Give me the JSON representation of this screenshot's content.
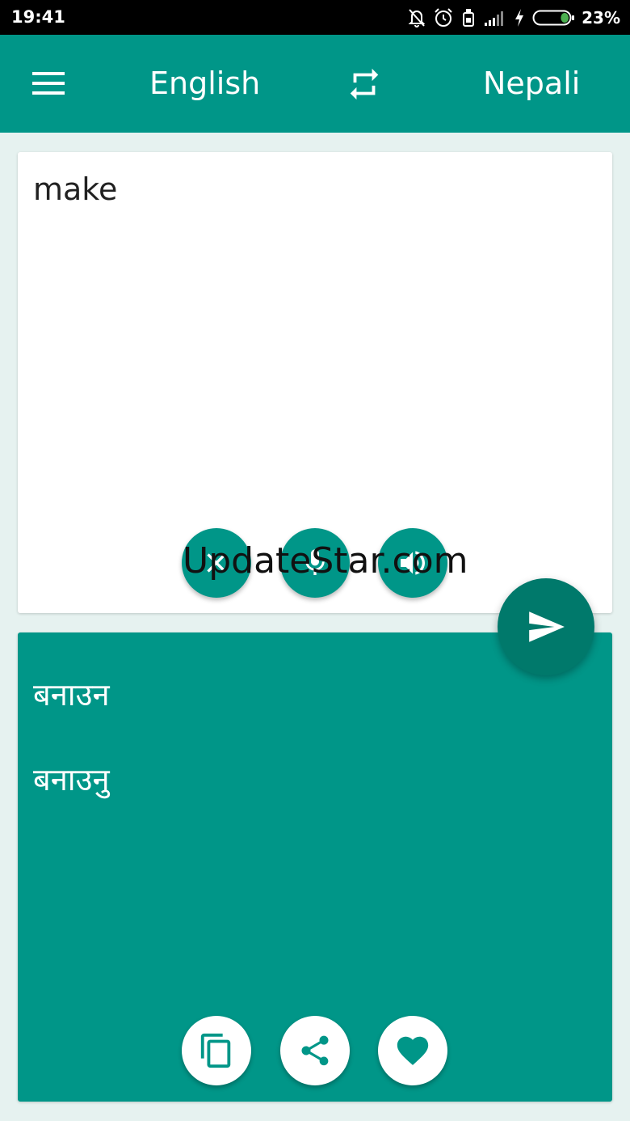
{
  "status_bar": {
    "time": "19:41",
    "battery_percent": "23%",
    "battery_level": 0.23,
    "icons": [
      "notifications-off-icon",
      "alarm-icon",
      "device-icon",
      "signal-icon",
      "charging-icon",
      "battery-icon"
    ]
  },
  "app_bar": {
    "menu_icon": "menu-icon",
    "source_language": "English",
    "swap_icon": "swap-icon",
    "target_language": "Nepali",
    "color": "#009688"
  },
  "input": {
    "text": "make",
    "buttons": [
      "clear-icon",
      "mic-icon",
      "speaker-icon"
    ]
  },
  "translate_button": {
    "icon": "send-icon",
    "color": "#00796b"
  },
  "output": {
    "lines": [
      "बनाउन",
      "बनाउनु"
    ],
    "buttons": [
      "copy-icon",
      "share-icon",
      "favorite-icon"
    ]
  },
  "watermark": "UpdateStar.com"
}
